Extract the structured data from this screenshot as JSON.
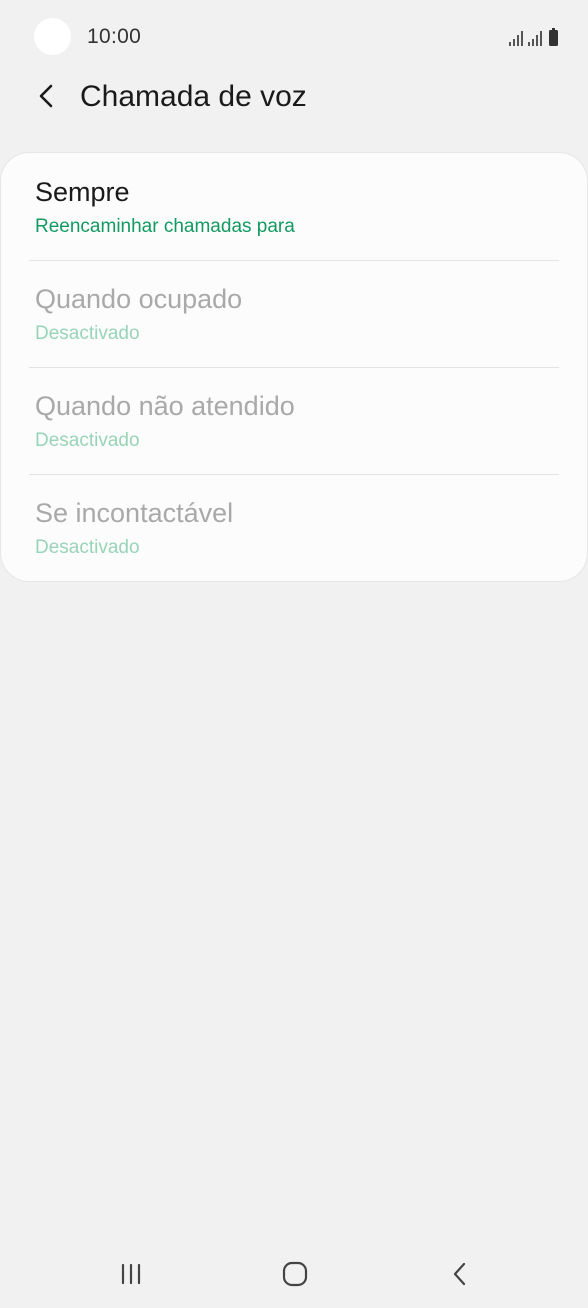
{
  "status_bar": {
    "time": "10:00",
    "icons": [
      "signal-icon",
      "signal-icon",
      "battery-icon"
    ]
  },
  "header": {
    "back_icon": "chevron-left-icon",
    "title": "Chamada de voz"
  },
  "forwarding_options": [
    {
      "title": "Sempre",
      "subtitle": "Reencaminhar chamadas para",
      "enabled": true
    },
    {
      "title": "Quando ocupado",
      "subtitle": "Desactivado",
      "enabled": false
    },
    {
      "title": "Quando não atendido",
      "subtitle": "Desactivado",
      "enabled": false
    },
    {
      "title": "Se incontactável",
      "subtitle": "Desactivado",
      "enabled": false
    }
  ],
  "navigation_bar": {
    "icons": [
      "recents-icon",
      "home-icon",
      "back-icon"
    ]
  },
  "colors": {
    "background": "#f1f1f1",
    "card": "#fcfcfc",
    "accent_green": "#139a62",
    "accent_green_disabled": "#98d4b8",
    "text_disabled": "#a9a9a9"
  }
}
